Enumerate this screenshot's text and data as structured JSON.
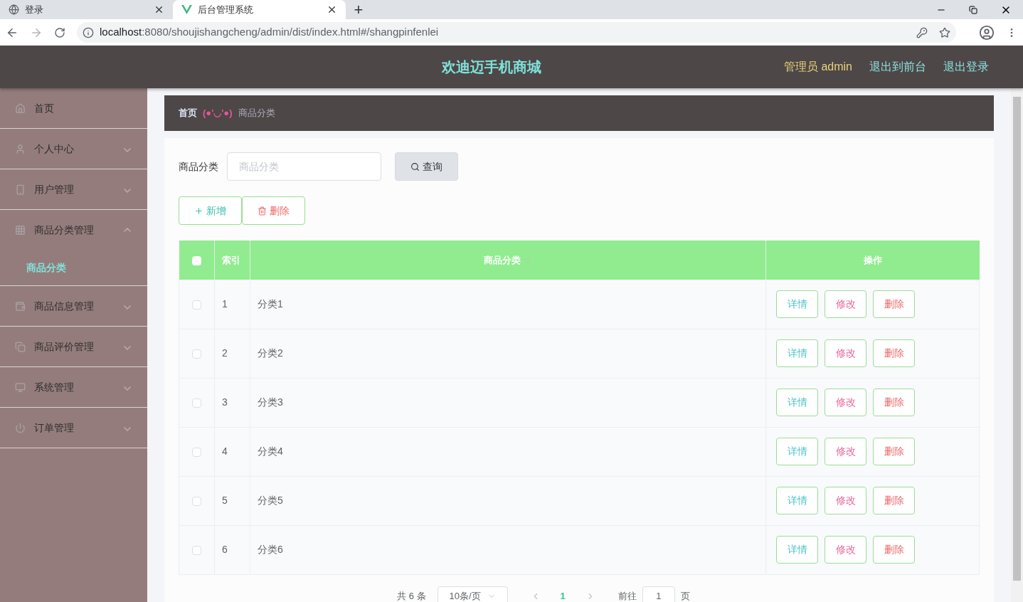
{
  "browser": {
    "tabs": [
      {
        "title": "登录",
        "selected": false
      },
      {
        "title": "后台管理系统",
        "selected": true
      }
    ],
    "new_tab": "+",
    "url_host": "localhost",
    "url_rest": ":8080/shoujishangcheng/admin/dist/index.html#/shangpinfenlei"
  },
  "header": {
    "title": "欢迪迈手机商城",
    "user": "管理员 admin",
    "links": [
      "退出到前台",
      "退出登录"
    ]
  },
  "sidebar": {
    "items": [
      {
        "label": "首页",
        "kind": "link"
      },
      {
        "label": "个人中心",
        "kind": "submenu",
        "expanded": false
      },
      {
        "label": "用户管理",
        "kind": "submenu",
        "expanded": false
      },
      {
        "label": "商品分类管理",
        "kind": "submenu",
        "expanded": true,
        "children": [
          {
            "label": "商品分类",
            "selected": true
          }
        ]
      },
      {
        "label": "商品信息管理",
        "kind": "submenu",
        "expanded": false
      },
      {
        "label": "商品评价管理",
        "kind": "submenu",
        "expanded": false
      },
      {
        "label": "系统管理",
        "kind": "submenu",
        "expanded": false
      },
      {
        "label": "订单管理",
        "kind": "submenu",
        "expanded": false
      }
    ]
  },
  "breadcrumb": {
    "home": "首页",
    "separator": "(●'◡'●)",
    "current": "商品分类"
  },
  "search": {
    "label": "商品分类",
    "placeholder": "商品分类",
    "button": "查询"
  },
  "actions": [
    {
      "label": "新增",
      "kind": "add"
    },
    {
      "label": "删除",
      "kind": "delete"
    }
  ],
  "table": {
    "header_checked": false,
    "columns": [
      "索引",
      "商品分类",
      "操作"
    ],
    "rows": [
      {
        "index": "1",
        "name": "分类1",
        "checked": false,
        "actions": [
          {
            "label": "详情",
            "kind": "detail"
          },
          {
            "label": "修改",
            "kind": "edit"
          },
          {
            "label": "删除",
            "kind": "delete"
          }
        ]
      },
      {
        "index": "2",
        "name": "分类2",
        "checked": false,
        "actions": [
          {
            "label": "详情",
            "kind": "detail"
          },
          {
            "label": "修改",
            "kind": "edit"
          },
          {
            "label": "删除",
            "kind": "delete"
          }
        ]
      },
      {
        "index": "3",
        "name": "分类3",
        "checked": false,
        "actions": [
          {
            "label": "详情",
            "kind": "detail"
          },
          {
            "label": "修改",
            "kind": "edit"
          },
          {
            "label": "删除",
            "kind": "delete"
          }
        ]
      },
      {
        "index": "4",
        "name": "分类4",
        "checked": false,
        "actions": [
          {
            "label": "详情",
            "kind": "detail"
          },
          {
            "label": "修改",
            "kind": "edit"
          },
          {
            "label": "删除",
            "kind": "delete"
          }
        ]
      },
      {
        "index": "5",
        "name": "分类5",
        "checked": false,
        "actions": [
          {
            "label": "详情",
            "kind": "detail"
          },
          {
            "label": "修改",
            "kind": "edit"
          },
          {
            "label": "删除",
            "kind": "delete"
          }
        ]
      },
      {
        "index": "6",
        "name": "分类6",
        "checked": false,
        "actions": [
          {
            "label": "详情",
            "kind": "detail"
          },
          {
            "label": "修改",
            "kind": "edit"
          },
          {
            "label": "删除",
            "kind": "delete"
          }
        ]
      }
    ]
  },
  "pagination": {
    "total": "共 6 条",
    "page_size": "10条/页",
    "pages": [
      {
        "label": "1",
        "selected": true
      }
    ],
    "goto_label": "前往",
    "goto_value": "1",
    "goto_suffix": "页"
  }
}
